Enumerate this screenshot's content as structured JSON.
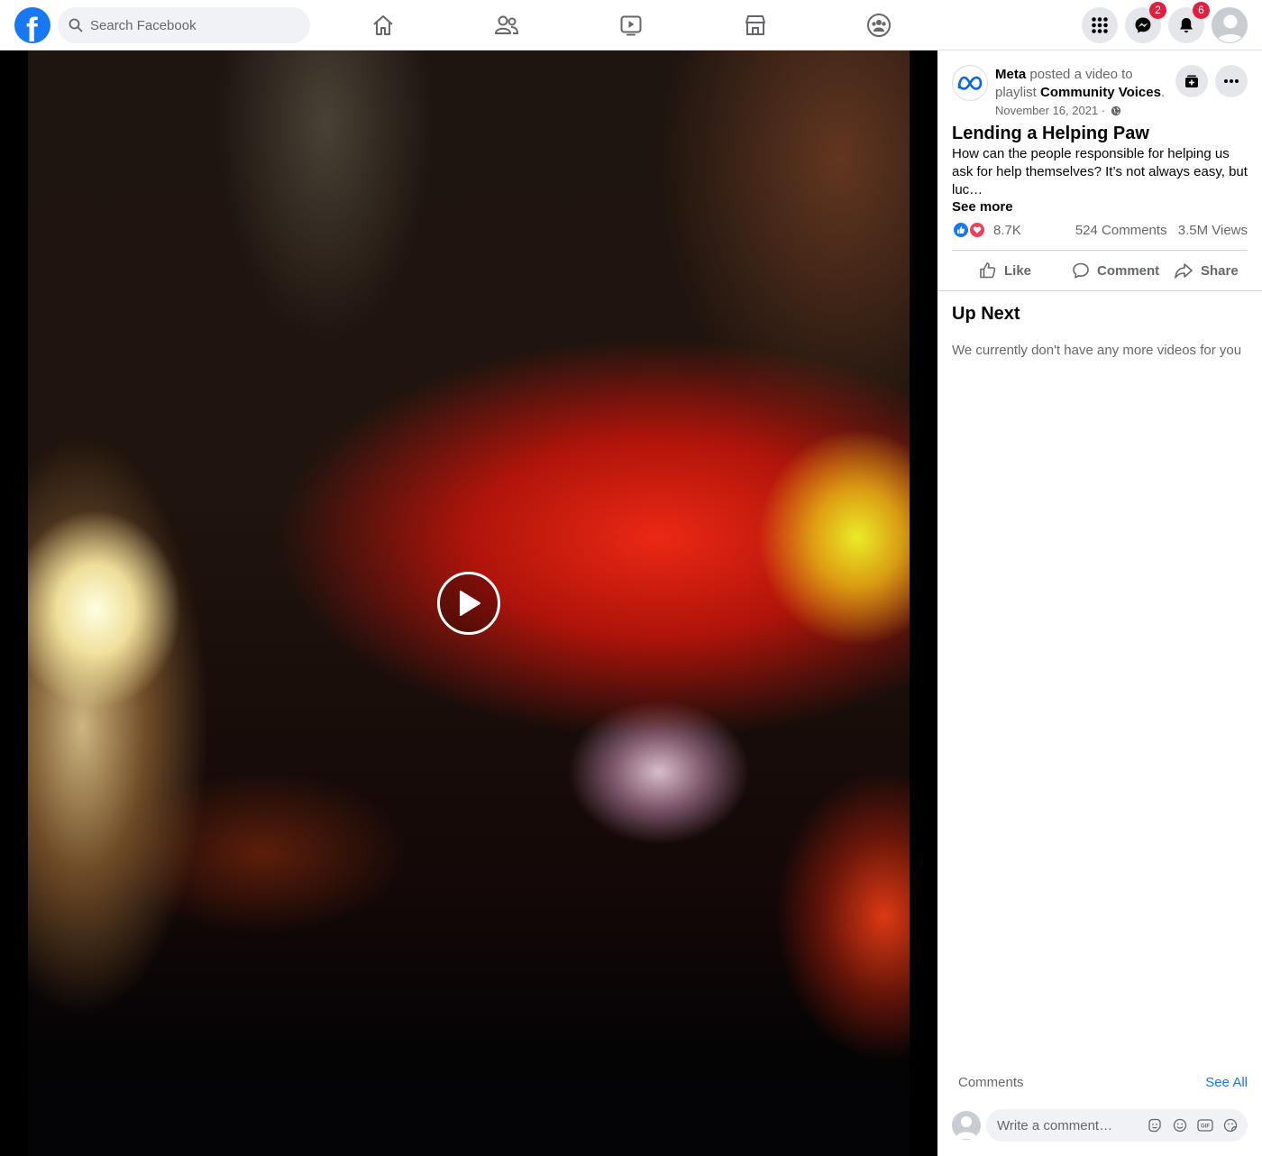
{
  "topbar": {
    "logo_letter": "f",
    "search_placeholder": "Search Facebook",
    "nav_tabs": [
      "home",
      "friends",
      "watch",
      "marketplace",
      "groups"
    ],
    "messenger_badge": "2",
    "notifications_badge": "6",
    "brand_color": "#1877f2",
    "badge_color": "#e41e3f"
  },
  "video": {
    "state": "paused"
  },
  "post": {
    "author": "Meta",
    "action_text": "posted a video to playlist",
    "playlist": "Community Voices",
    "date": "November 16, 2021 ·",
    "title": "Lending a Helping Paw",
    "description": "How can the people responsible for helping us ask for help themselves? It’s not always easy, but luc…",
    "see_more": "See more",
    "reaction_count": "8.7K",
    "comments_count": "524 Comments",
    "views_count": "3.5M Views",
    "actions": {
      "like": "Like",
      "comment": "Comment",
      "share": "Share"
    }
  },
  "up_next": {
    "heading": "Up Next",
    "empty_message": "We currently don't have any more videos for you"
  },
  "comments": {
    "label": "Comments",
    "see_all": "See All",
    "input_placeholder": "Write a comment…"
  }
}
